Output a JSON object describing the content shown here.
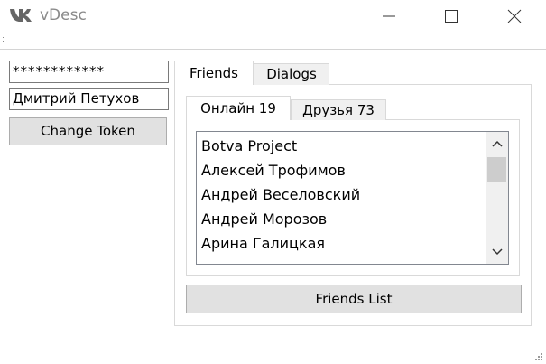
{
  "window": {
    "title": "vDesc",
    "logo_text": "VK",
    "controls": [
      "minimize",
      "maximize",
      "close"
    ]
  },
  "left_panel": {
    "token_value": "************",
    "user_name": "Дмитрий Петухов",
    "change_token_label": "Change Token"
  },
  "main_tabs": [
    {
      "label": "Friends",
      "selected": true
    },
    {
      "label": "Dialogs",
      "selected": false
    }
  ],
  "sub_tabs": [
    {
      "label": "Онлайн 19",
      "selected": true
    },
    {
      "label": "Друзья 73",
      "selected": false
    }
  ],
  "friends_list": {
    "items": [
      "Botva Project",
      "Алексей Трофимов",
      "Андрей Веселовский",
      "Андрей Морозов",
      "Арина Галицкая"
    ]
  },
  "friends_list_button": "Friends List",
  "colors": {
    "button_bg": "#e1e1e1",
    "scrollbar_bg": "#f0f0f0",
    "scroll_thumb": "#cdcdcd",
    "title_text": "#8a8a8a"
  }
}
